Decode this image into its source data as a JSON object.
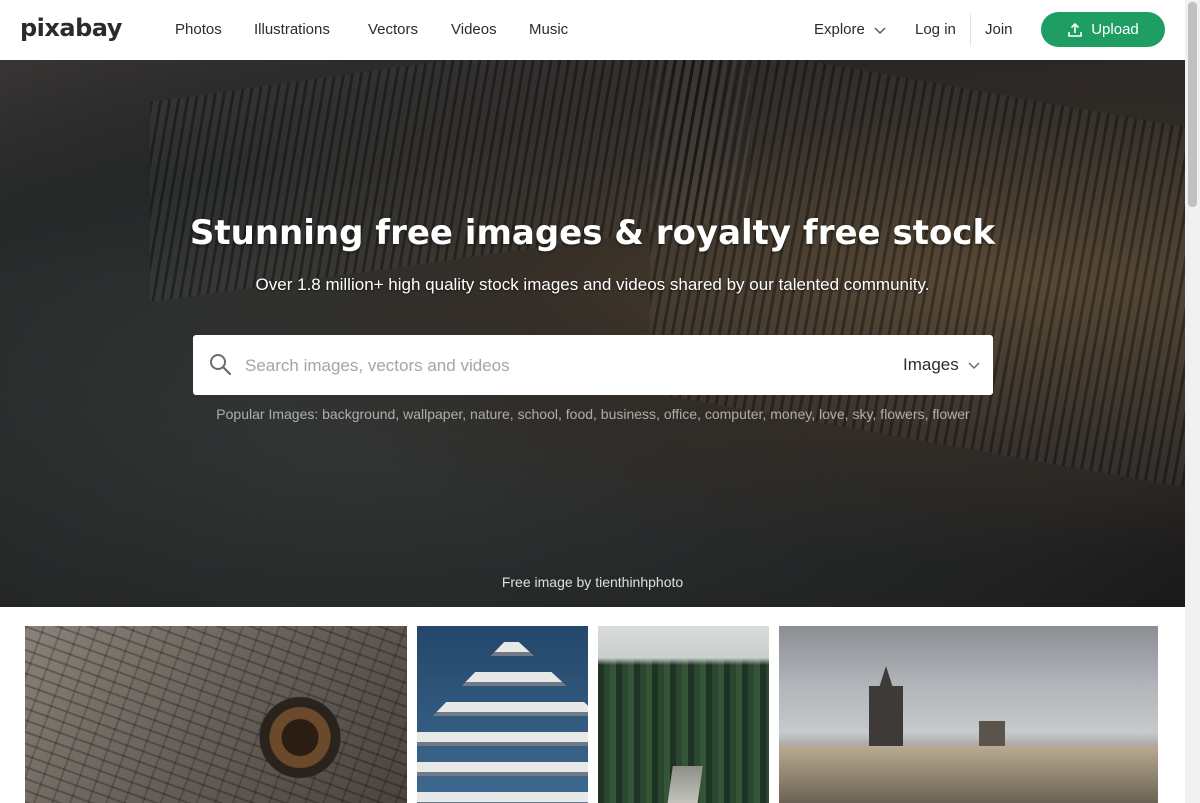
{
  "header": {
    "logo": "pixabay",
    "nav": [
      {
        "label": "Photos"
      },
      {
        "label": "Illustrations"
      },
      {
        "label": "Vectors"
      },
      {
        "label": "Videos"
      },
      {
        "label": "Music"
      }
    ],
    "explore_label": "Explore",
    "login_label": "Log in",
    "join_label": "Join",
    "upload_label": "Upload",
    "accent_color": "#1f9e63"
  },
  "hero": {
    "title": "Stunning free images & royalty free stock",
    "subtitle": "Over 1.8 million+ high quality stock images and videos shared by our talented community.",
    "search": {
      "placeholder": "Search images, vectors and videos",
      "value": "",
      "media_type": "Images"
    },
    "popular_prefix": "Popular Images:",
    "popular_tags": [
      "background",
      "wallpaper",
      "nature",
      "school",
      "food",
      "business",
      "office",
      "computer",
      "money",
      "love",
      "sky",
      "flowers",
      "flower"
    ],
    "credit": "Free image by tienthinhphoto"
  },
  "gallery": {
    "icons": [
      "elephant-eye-photo",
      "building-photo",
      "forest-photo",
      "prague-city-photo"
    ]
  }
}
